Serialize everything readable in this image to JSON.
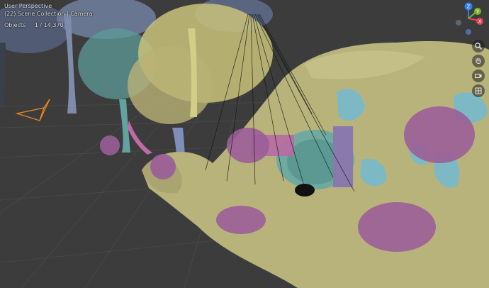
{
  "header": {
    "view_name": "User Perspective",
    "collection_path": "(22) Scene Collection | Camera"
  },
  "stats": {
    "objects_label": "Objects",
    "objects_value": "1 / 14,370"
  },
  "gizmo": {
    "axis_z": "Z",
    "axis_y": "Y",
    "axis_x": "X",
    "colors": {
      "x": "#e14353",
      "y": "#76b62b",
      "z": "#2f7ff0",
      "neg": "#5b6678"
    }
  },
  "nav_icons": [
    "zoom-icon",
    "hand-pan-icon",
    "camera-view-icon",
    "grid-ortho-icon"
  ],
  "scene_colors": {
    "background": "#3c3c3c",
    "terrain": "#b8b37a",
    "tree_blue": "#6f7fa0",
    "foliage_yellow": "#c9c27a",
    "hobbit_door": "#63a7a2",
    "flowers": "#9b5e98",
    "rock_teal": "#7db9c4",
    "camera": "#f08a1f"
  }
}
